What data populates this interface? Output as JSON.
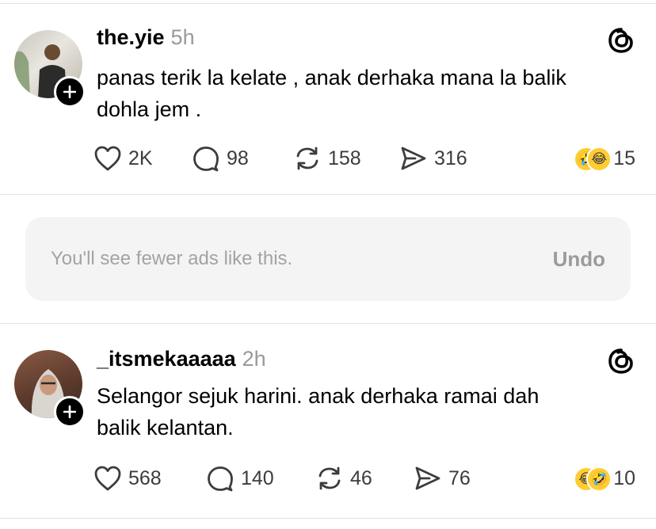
{
  "posts": [
    {
      "username": "the.yie",
      "time": "5h",
      "text_lines": [
        "panas terik la kelate , anak derhaka mana la balik",
        "dohla jem ."
      ],
      "likes": "2K",
      "replies": "98",
      "reposts": "158",
      "shares": "316",
      "reaction_count": "15",
      "reaction_emojis": [
        "🤣",
        "😂"
      ]
    },
    {
      "username": "_itsmekaaaaa",
      "time": "2h",
      "text_lines": [
        "Selangor sejuk harini. anak derhaka ramai dah",
        "balik kelantan."
      ],
      "likes": "568",
      "replies": "140",
      "reposts": "46",
      "shares": "76",
      "reaction_count": "10",
      "reaction_emojis": [
        "😂",
        "🤣"
      ]
    }
  ],
  "notice": {
    "text": "You'll see fewer ads like this.",
    "undo_label": "Undo"
  },
  "icons": {
    "like": "heart-icon",
    "reply": "comment-icon",
    "repost": "repost-icon",
    "share": "send-icon",
    "app": "threads-logo-icon",
    "follow": "plus-icon"
  }
}
